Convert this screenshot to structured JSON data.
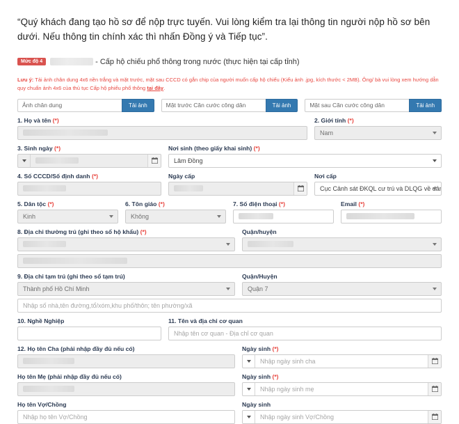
{
  "intro": "“Quý khách đang tạo hồ sơ để nộp trực tuyến. Vui lòng kiểm tra lại thông tin người nộp hồ sơ bên dưới. Nếu thông tin chính xác thì nhấn Đồng ý và Tiếp tục”.",
  "service": {
    "badge": "Mức độ 4",
    "name_redacted": true,
    "title": "- Cấp hộ chiếu phổ thông trong nước (thực hiện tại cấp tỉnh)"
  },
  "note": {
    "prefix": "Lưu ý:",
    "body": " Tải ảnh chân dung 4x6 nền trắng và mặt trước, mặt sau CCCD có gắn chip của người muốn cấp hộ chiếu (Kiểu ảnh .jpg, kích thước < 2MB). Ông/ bà vui lòng xem hướng dẫn quy chuẩn ảnh 4x6 của thủ tục Cấp hộ phiếu phổ thông ",
    "link": "tại đây",
    "suffix": "."
  },
  "uploads": [
    {
      "placeholder": "Ảnh chân dung",
      "button": "Tải ảnh"
    },
    {
      "placeholder": "Mặt trước Căn cước công dân",
      "button": "Tải ảnh"
    },
    {
      "placeholder": "Mặt sau Căn cước công dân",
      "button": "Tải ảnh"
    }
  ],
  "fields": {
    "full_name": {
      "label": "1. Họ và tên",
      "required": true,
      "value": "",
      "redacted": true
    },
    "gender": {
      "label": "2. Giới tính",
      "required": true,
      "value": "Nam"
    },
    "birth_date": {
      "label": "3. Sinh ngày",
      "required": true,
      "value": "",
      "redacted": true
    },
    "birth_place": {
      "label": "Nơi sinh (theo giấy khai sinh)",
      "required": true,
      "value": "Lâm Đồng"
    },
    "id_number": {
      "label": "4. Số CCCD/Số định danh",
      "required": true,
      "value": "",
      "redacted": true
    },
    "issue_date": {
      "label": "Ngày cấp",
      "required": false,
      "value": "",
      "redacted": true
    },
    "issue_place": {
      "label": "Nơi cấp",
      "required": false,
      "value": "Cục Cảnh sát ĐKQL cư trú và DLQG về dân cư"
    },
    "ethnicity": {
      "label": "5. Dân tộc",
      "required": true,
      "value": "Kinh"
    },
    "religion": {
      "label": "6. Tôn giáo",
      "required": true,
      "value": "Không"
    },
    "phone": {
      "label": "7. Số điện thoại",
      "required": true,
      "value": "",
      "redacted": true
    },
    "email": {
      "label": "Email",
      "required": true,
      "value": "",
      "redacted": true
    },
    "permanent_address": {
      "label": "8. Địa chỉ thường trú (ghi theo sổ hộ khẩu)",
      "required": true,
      "value": "",
      "redacted": true
    },
    "permanent_district": {
      "label": "Quận/huyện",
      "required": false,
      "value": "",
      "redacted": true
    },
    "permanent_detail": {
      "value": "",
      "redacted": true
    },
    "temp_address": {
      "label": "9. Địa chỉ tạm trú (ghi theo sổ tạm trú)",
      "required": false,
      "value": "Thành phố Hồ Chí Minh"
    },
    "temp_district": {
      "label": "Quận/Huyện",
      "required": false,
      "value": "Quận 7"
    },
    "temp_detail": {
      "placeholder": "Nhập số nhà,tên đường,tổ/xóm,khu phố/thôn; tên phường/xã"
    },
    "occupation": {
      "label": "10. Nghề Nghiệp",
      "required": false,
      "value": ""
    },
    "org": {
      "label": "11. Tên và địa chỉ cơ quan",
      "required": false,
      "placeholder": "Nhập tên cơ quan - Địa chỉ cơ quan"
    },
    "father_name": {
      "label": "12. Họ tên Cha (phải nhập đầy đủ nếu có)",
      "required": false,
      "value": "",
      "redacted": true
    },
    "father_dob": {
      "label": "Ngày sinh",
      "required": true,
      "placeholder": "Nhập ngày sinh cha"
    },
    "mother_name": {
      "label": "Họ tên Mẹ (phải nhập đầy đủ nếu có)",
      "required": false,
      "value": "",
      "redacted": true
    },
    "mother_dob": {
      "label": "Ngày sinh",
      "required": true,
      "placeholder": "Nhập ngày sinh mẹ"
    },
    "spouse_name": {
      "label": "Họ tên Vợ/Chồng",
      "required": false,
      "placeholder": "Nhập họ tên Vợ/Chồng"
    },
    "spouse_dob": {
      "label": "Ngày sinh",
      "required": false,
      "placeholder": "Nhập ngày sinh Vợ/Chồng"
    }
  },
  "colors": {
    "accent_blue": "#3479b0",
    "badge_red": "#d9534f",
    "required_red": "#e8463f",
    "label_navy": "#2b3a52"
  }
}
